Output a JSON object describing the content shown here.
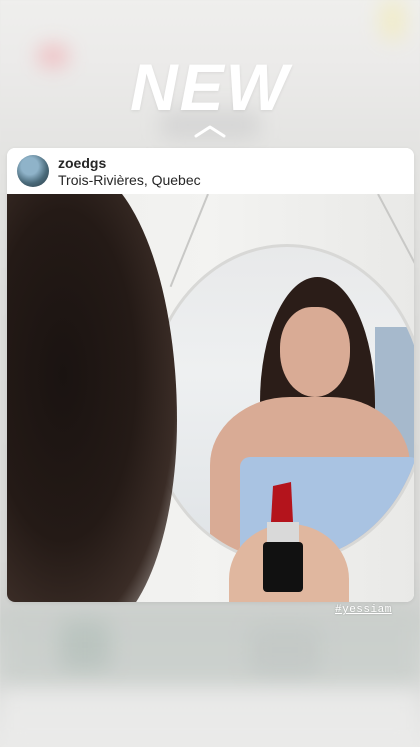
{
  "story": {
    "title": "NEW",
    "hashtag": "#yessiam"
  },
  "post": {
    "username": "zoedgs",
    "location": "Trois-Rivières, Quebec"
  },
  "icons": {
    "swipe_up": "chevron-up-icon"
  },
  "colors": {
    "card_bg": "#ffffff",
    "text": "#262626",
    "title": "#ffffff"
  }
}
